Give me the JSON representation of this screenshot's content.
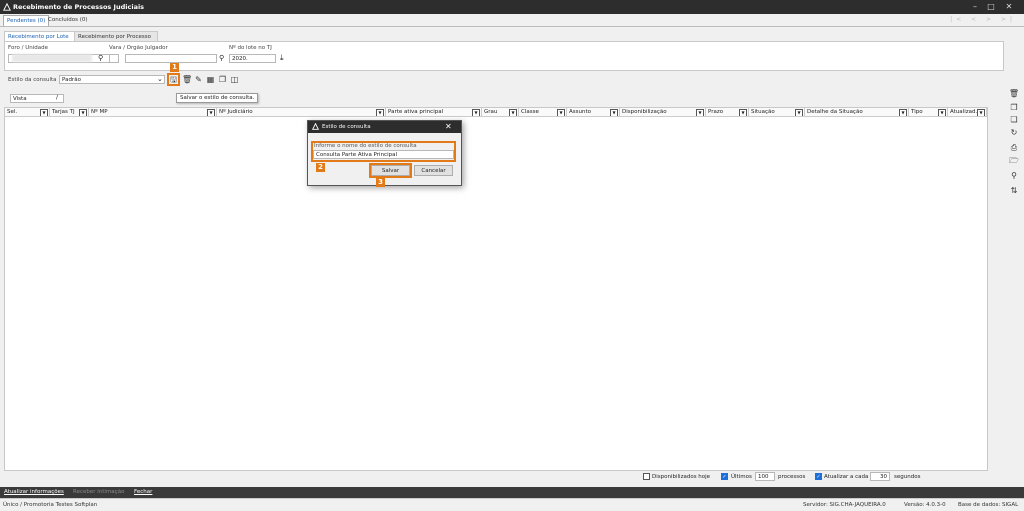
{
  "window": {
    "title": "Recebimento de Processos Judiciais"
  },
  "tabs": [
    {
      "label": "Pendentes (0)"
    },
    {
      "label": "Concluídos (0)"
    }
  ],
  "subtabs": [
    {
      "label": "Recebimento por Lote"
    },
    {
      "label": "Recebimento por Processo"
    }
  ],
  "filters": {
    "foro_label": "Foro / Unidade",
    "vara_label": "Vara / Orgão Julgador",
    "lote_label": "Nº do lote no TJ",
    "lote_value": "2020."
  },
  "toolbar": {
    "estilo_label": "Estilo da consulta",
    "estilo_value": "Padrão",
    "tooltip": "Salvar o estilo de consulta."
  },
  "vista": {
    "label": "Vista"
  },
  "columns": [
    {
      "label": "Sel."
    },
    {
      "label": "Tarjas TJ"
    },
    {
      "label": "Nº MP"
    },
    {
      "label": "Nº Judiciário"
    },
    {
      "label": "Parte ativa principal"
    },
    {
      "label": "Grau"
    },
    {
      "label": "Classe"
    },
    {
      "label": "Assunto"
    },
    {
      "label": "Disponibilização"
    },
    {
      "label": "Prazo"
    },
    {
      "label": "Situação"
    },
    {
      "label": "Detalhe da Situação"
    },
    {
      "label": "Tipo"
    },
    {
      "label": "Atualizad.."
    }
  ],
  "markers": [
    "1",
    "2",
    "3"
  ],
  "modal": {
    "title": "Estilo de consulta",
    "field_label": "Informe o nome do estilo de consulta",
    "field_value": "Consulta Parte Ativa Principal",
    "save": "Salvar",
    "cancel": "Cancelar"
  },
  "bottom": {
    "disponibilizados": "Disponibilizados hoje",
    "ultimos": "Últimos",
    "ultimos_value": "100",
    "processos": "processos",
    "atualizar": "Atualizar a cada",
    "atualizar_value": "30",
    "segundos": "segundos"
  },
  "actions": {
    "atualizar": "Atualizar informações",
    "receber": "Receber intimação",
    "fechar": "Fechar"
  },
  "status": {
    "left": "Único / Promotoria Testes Softplan",
    "servidor": "Servidor: SIG.CHA-JAQUEIRA.0",
    "versao": "Versão: 4.0.3-0",
    "base": "Base de dados: SIGAL"
  },
  "colors": {
    "accent": "#e27a17",
    "check": "#1e6fd9",
    "titlebar": "#2d2d2d"
  }
}
